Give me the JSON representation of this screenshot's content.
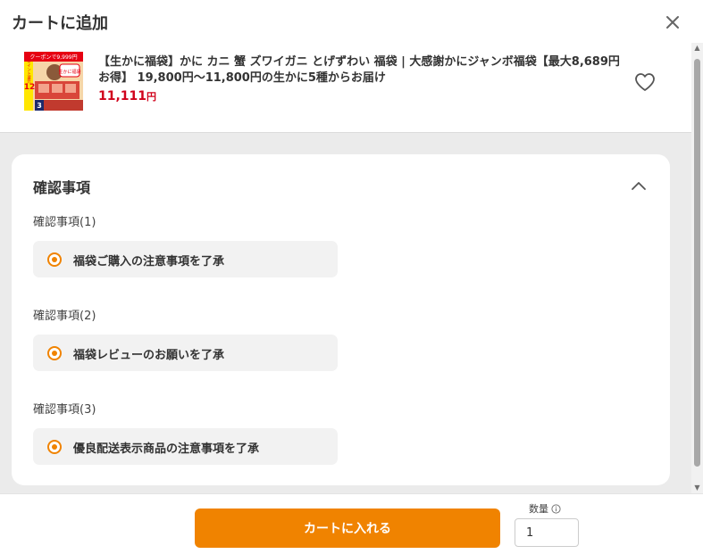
{
  "dialog": {
    "title": "カートに追加"
  },
  "product": {
    "name": "【生かに福袋】かに カニ 蟹 ズワイガニ とげずわい 福袋 | 大感謝かにジャンボ福袋【最大8,689円お得】 19,800円～11,800円の生かに5種からお届け",
    "price": "11,111",
    "price_unit": "円",
    "thumbnail": {
      "banner_text": "クーポンで9,999円",
      "side_text": "ポイント還元",
      "badge_text": "生かに福袋",
      "big_number": "12",
      "small_number": "3"
    }
  },
  "confirm_section": {
    "title": "確認事項",
    "items": [
      {
        "label": "確認事項(1)",
        "option": "福袋ご購入の注意事項を了承"
      },
      {
        "label": "確認事項(2)",
        "option": "福袋レビューのお願いを了承"
      },
      {
        "label": "確認事項(3)",
        "option": "優良配送表示商品の注意事項を了承"
      }
    ]
  },
  "footer": {
    "cart_button_label": "カートに入れる",
    "quantity_label": "数量",
    "quantity_value": "1"
  },
  "colors": {
    "accent": "#f08300",
    "price": "#d0021b",
    "panel_bg": "#ebebeb"
  }
}
